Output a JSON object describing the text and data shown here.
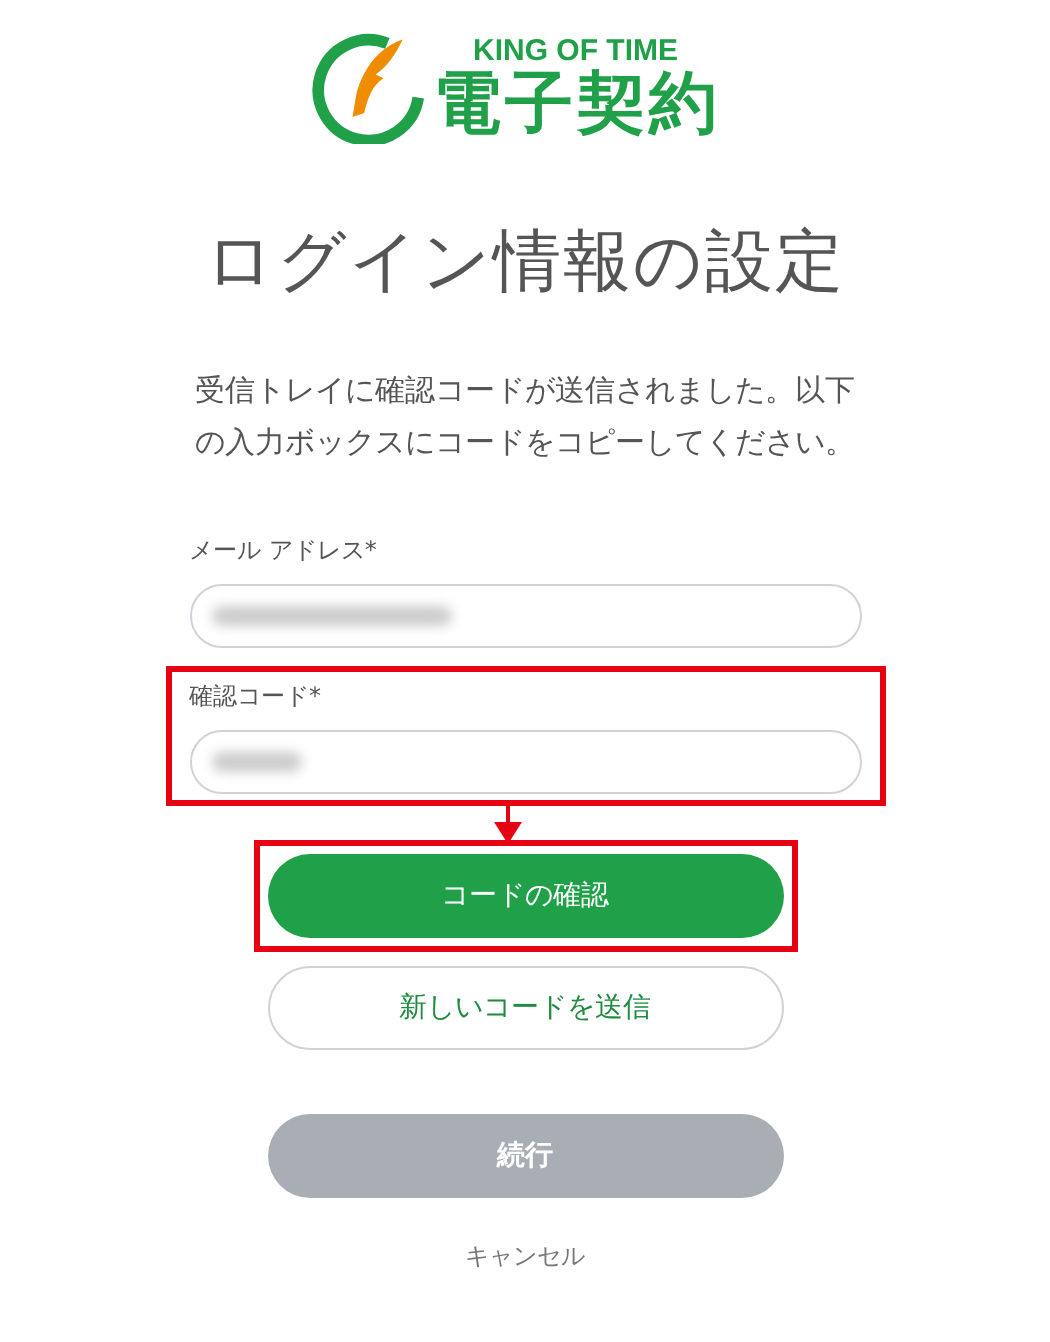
{
  "logo": {
    "tagline": "KING OF TIME",
    "name": "電子契約"
  },
  "title": "ログイン情報の設定",
  "message": "受信トレイに確認コードが送信されました。以下の入力ボックスにコードをコピーしてください。",
  "fields": [
    {
      "label": "メール アドレス*",
      "highlighted": false
    },
    {
      "label": "確認コード*",
      "highlighted": true
    }
  ],
  "buttons": [
    {
      "label": "コードの確認",
      "kind": "primary",
      "disabled": false,
      "highlighted": true
    },
    {
      "label": "新しいコードを送信",
      "kind": "outline",
      "disabled": false,
      "highlighted": false
    },
    {
      "label": "続行",
      "kind": "primary",
      "disabled": true,
      "highlighted": false
    }
  ],
  "cancel_link": "キャンセル"
}
